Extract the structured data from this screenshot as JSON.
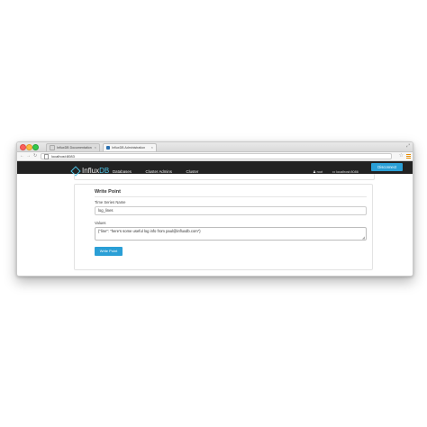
{
  "browser": {
    "tabs": [
      {
        "title": "InfluxDB Documentation",
        "close": "×"
      },
      {
        "title": "InfluxDB Administration",
        "close": "×"
      }
    ],
    "address": "localhost:8083"
  },
  "navbar": {
    "logo_prefix": "Influx",
    "logo_suffix": "DB",
    "links": [
      "Databases",
      "Cluster Admins",
      "Cluster"
    ],
    "user": "root",
    "host": "localhost:8086",
    "disconnect_label": "Disconnect"
  },
  "form": {
    "title": "Write Point",
    "series_label": "Time Series Name",
    "series_value": "log_lines",
    "values_label": "Values",
    "values_value": "{\"line\": \"here's some useful log info from paul@influxdb.com\"}",
    "submit_label": "Write Point"
  },
  "colors": {
    "navbar": "#222222",
    "accent": "#2a9fd6",
    "logo_accent": "#4dc3e6"
  }
}
